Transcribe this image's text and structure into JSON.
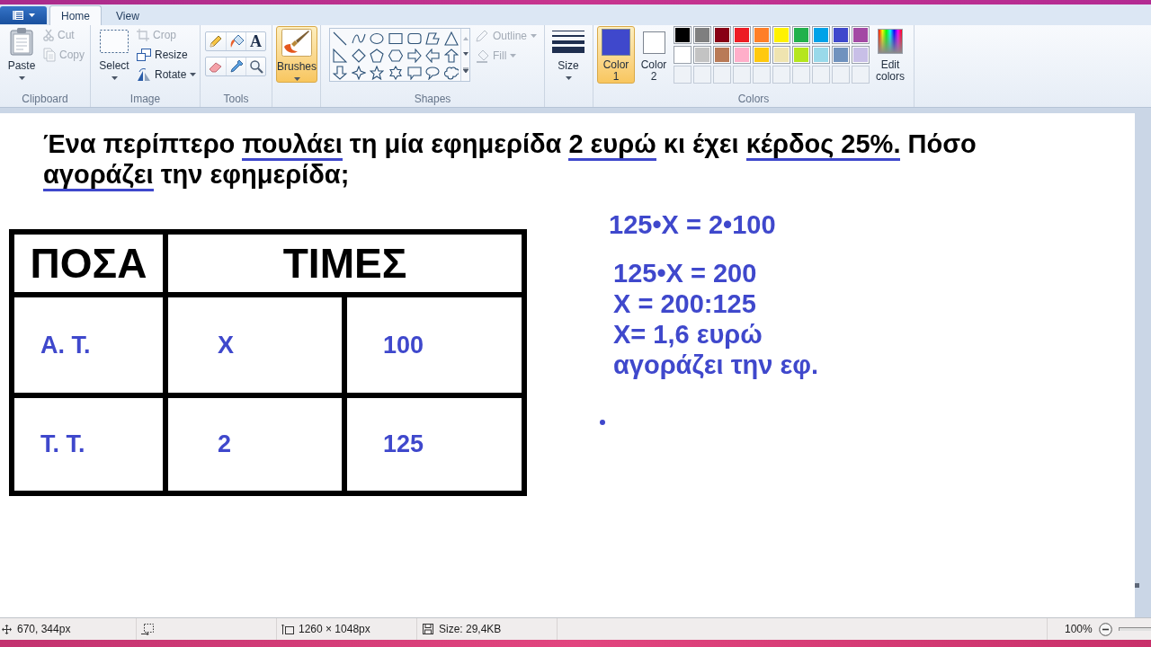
{
  "tabs": [
    {
      "label": "Home",
      "selected": true
    },
    {
      "label": "View",
      "selected": false
    }
  ],
  "ribbon": {
    "clipboard": {
      "group_label": "Clipboard",
      "paste": "Paste",
      "cut": {
        "label": "Cut",
        "disabled": true
      },
      "copy": {
        "label": "Copy",
        "disabled": true
      }
    },
    "image": {
      "group_label": "Image",
      "select": "Select",
      "crop": {
        "label": "Crop",
        "disabled": true
      },
      "resize": {
        "label": "Resize",
        "disabled": false
      },
      "rotate": {
        "label": "Rotate",
        "disabled": false
      }
    },
    "tools": {
      "group_label": "Tools",
      "items": [
        {
          "kind": "pencil",
          "selected": false
        },
        {
          "kind": "fill",
          "selected": false
        },
        {
          "kind": "text",
          "glyph": "A",
          "selected": false
        },
        {
          "kind": "eraser",
          "selected": false
        },
        {
          "kind": "color_picker",
          "selected": false
        },
        {
          "kind": "magnifier",
          "selected": false
        }
      ]
    },
    "brushes": {
      "label": "Brushes",
      "selected": true
    },
    "shapes": {
      "group_label": "Shapes",
      "outline": {
        "label": "Outline",
        "disabled": true
      },
      "fill": {
        "label": "Fill",
        "disabled": true
      }
    },
    "size": {
      "label": "Size"
    },
    "colors": {
      "group_label": "Colors",
      "color_1": {
        "label": "Color 1",
        "color": "#3f48cc",
        "selected": true
      },
      "color_2": {
        "label": "Color 2",
        "color": "#ffffff",
        "selected": false
      },
      "palette": [
        [
          {
            "color": "#000000"
          },
          {
            "color": "#7f7f7f"
          },
          {
            "color": "#880015"
          },
          {
            "color": "#ed1c24"
          },
          {
            "color": "#ff7f27"
          },
          {
            "color": "#fff200"
          },
          {
            "color": "#22b14c"
          },
          {
            "color": "#00a2e8"
          },
          {
            "color": "#3f48cc"
          },
          {
            "color": "#a349a4"
          }
        ],
        [
          {
            "color": "#ffffff"
          },
          {
            "color": "#c3c3c3"
          },
          {
            "color": "#b97a57"
          },
          {
            "color": "#ffaec9"
          },
          {
            "color": "#ffc90e"
          },
          {
            "color": "#efe4b0"
          },
          {
            "color": "#b5e61d"
          },
          {
            "color": "#99d9ea"
          },
          {
            "color": "#7092be"
          },
          {
            "color": "#c8bfe7"
          }
        ]
      ],
      "edit_colors": "Edit colors"
    }
  },
  "canvas": {
    "question": [
      {
        "text": "Ένα περίπτερο ",
        "underlined": false
      },
      {
        "text": "πουλάει",
        "underlined": true
      },
      {
        "text": " τη μία εφημερίδα ",
        "underlined": false
      },
      {
        "text": "2 ευρώ",
        "underlined": true
      },
      {
        "text": " κι έχει ",
        "underlined": false
      },
      {
        "text": "κέρδος 25%.",
        "underlined": true
      },
      {
        "text": " Πόσο ",
        "underlined": false
      },
      {
        "text": "αγοράζει",
        "underlined": true
      },
      {
        "text": " την εφημερίδα;",
        "underlined": false
      }
    ],
    "table": {
      "headers": [
        "ΠΟΣΑ",
        "ΤΙΜΕΣ"
      ],
      "rows": [
        [
          "Α. Τ.",
          "X",
          "100"
        ],
        [
          "Τ. Τ.",
          "2",
          "125"
        ]
      ]
    },
    "equation": "125•X = 2•100",
    "solution": [
      "125•X = 200",
      "X = 200:125",
      "X= 1,6 ευρώ",
      "αγοράζει την εφ."
    ]
  },
  "status_bar": {
    "cursor_position": "670, 344px",
    "canvas_size": "1260 × 1048px",
    "file_size": "Size: 29,4KB",
    "zoom": "100%"
  }
}
